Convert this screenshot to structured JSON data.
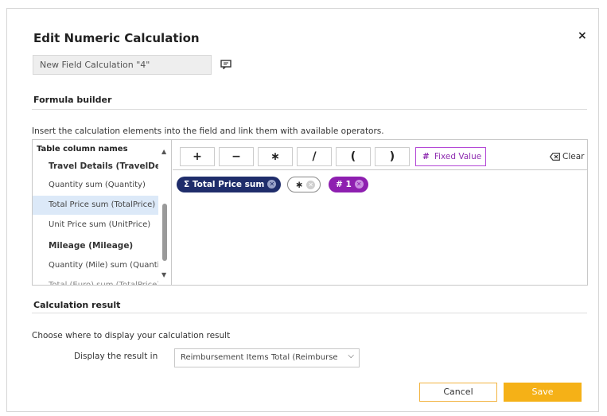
{
  "dialog": {
    "title": "Edit Numeric Calculation",
    "close_label": "×",
    "name_value": "New Field Calculation \"4\""
  },
  "formula_builder": {
    "title": "Formula builder",
    "instructions": "Insert the calculation elements into the field and link them with available operators.",
    "columns_header": "Table column names",
    "columns": [
      {
        "label": "Travel Details (TravelDeta...",
        "type": "group"
      },
      {
        "label": "Quantity sum (Quantity)",
        "type": "item"
      },
      {
        "label": "Total Price sum (TotalPrice)",
        "type": "item",
        "selected": true
      },
      {
        "label": "Unit Price sum (UnitPrice)",
        "type": "item"
      },
      {
        "label": "Mileage (Mileage)",
        "type": "group"
      },
      {
        "label": "Quantity (Mile) sum (Quantity)",
        "type": "item"
      },
      {
        "label": "Total (Euro) sum (TotalPrice)",
        "type": "item"
      }
    ],
    "operators": [
      "+",
      "−",
      "∗",
      "/",
      "(",
      ")"
    ],
    "fixed_value_icon": "#",
    "fixed_value_label": "Fixed Value",
    "clear_label": "Clear",
    "tokens": {
      "field": {
        "symbol": "Σ",
        "label": "Total Price sum"
      },
      "operator": {
        "label": "∗"
      },
      "value": {
        "symbol": "#",
        "label": "1"
      }
    }
  },
  "result": {
    "title": "Calculation result",
    "instructions": "Choose where to display your calculation result",
    "display_label": "Display the result in",
    "display_value": "Reimbursement Items Total (Reimburse"
  },
  "footer": {
    "cancel_label": "Cancel",
    "save_label": "Save"
  },
  "colors": {
    "accent": "#f5b117",
    "field_token": "#1f2d6b",
    "value_token": "#8e1fb0",
    "selected_row": "#dce9f8"
  },
  "icons": {
    "comment": "comment-icon",
    "clear": "backspace-icon",
    "close": "close-icon",
    "dropdown": "chevron-down-icon"
  }
}
